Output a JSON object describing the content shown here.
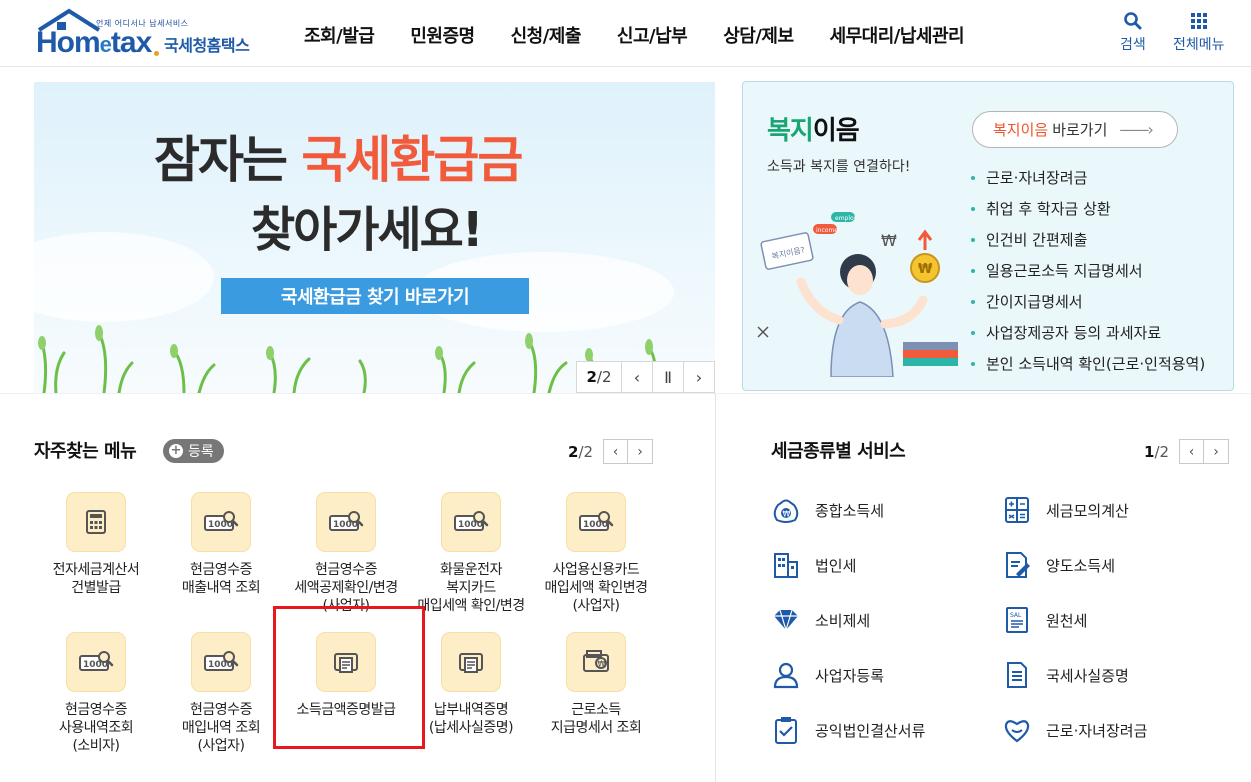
{
  "header": {
    "logo_tagline": "언제 어디서나 납세서비스",
    "logo_word_start": "Hom",
    "logo_word_e": "e",
    "logo_word_end": "tax",
    "logo_kr": "국세청홈택스",
    "nav": [
      "조회/발급",
      "민원증명",
      "신청/제출",
      "신고/납부",
      "상담/제보",
      "세무대리/납세관리"
    ],
    "search_label": "검색",
    "menu_label": "전체메뉴"
  },
  "banner": {
    "line1_prefix": "잠자는 ",
    "line1_highlight": "국세환급금",
    "line2": "찾아가세요!",
    "cta": "국세환급금 찾기 바로가기",
    "page_current": "2",
    "page_sep": "/",
    "page_total": "2",
    "prev_icon": "‹",
    "pause_icon": "Ⅱ",
    "next_icon": "›"
  },
  "welfare": {
    "title_green": "복지",
    "title_rest": "이음",
    "subtitle": "소득과 복지를 연결하다!",
    "button_red": "복지이음",
    "button_rest": "바로가기",
    "items": [
      "근로·자녀장려금",
      "취업 후 학자금 상환",
      "인건비 간편제출",
      "일용근로소득 지급명세서",
      "간이지급명세서",
      "사업장제공자 등의 과세자료",
      "본인 소득내역 확인(근로·인적용역)"
    ],
    "sign_text": "복지이음?",
    "tag1": "employ",
    "tag2": "income"
  },
  "favorites": {
    "title": "자주찾는 메뉴",
    "add_label": "등록",
    "page_current": "2",
    "page_total": "/2",
    "items": [
      {
        "label": "전자세금계산서\n건별발급",
        "icon": "calculator-icon"
      },
      {
        "label": "현금영수증\n매출내역 조회",
        "icon": "receipt-search-icon"
      },
      {
        "label": "현금영수증\n세액공제확인/변경\n(사업자)",
        "icon": "receipt-search-icon"
      },
      {
        "label": "화물운전자\n복지카드\n매입세액 확인/변경",
        "icon": "receipt-search-icon"
      },
      {
        "label": "사업용신용카드\n매입세액 확인변경\n(사업자)",
        "icon": "receipt-search-icon"
      },
      {
        "label": "현금영수증\n사용내역조회\n(소비자)",
        "icon": "receipt-search-icon"
      },
      {
        "label": "현금영수증\n매입내역 조회\n(사업자)",
        "icon": "receipt-search-icon"
      },
      {
        "label": "소득금액증명발급",
        "icon": "printer-icon"
      },
      {
        "label": "납부내역증명\n(납세사실증명)",
        "icon": "printer-icon"
      },
      {
        "label": "근로소득\n지급명세서 조회",
        "icon": "wallet-icon"
      }
    ],
    "money_text": "1000"
  },
  "tax_services": {
    "title": "세금종류별 서비스",
    "page_current": "1",
    "page_total": "/2",
    "items": [
      {
        "label": "종합소득세",
        "icon": "money-bag-icon"
      },
      {
        "label": "세금모의계산",
        "icon": "calculator-icon"
      },
      {
        "label": "법인세",
        "icon": "building-icon"
      },
      {
        "label": "양도소득세",
        "icon": "document-edit-icon"
      },
      {
        "label": "소비제세",
        "icon": "diamond-icon"
      },
      {
        "label": "원천세",
        "icon": "receipt-icon"
      },
      {
        "label": "사업자등록",
        "icon": "person-icon"
      },
      {
        "label": "국세사실증명",
        "icon": "document-icon"
      },
      {
        "label": "공익법인결산서류",
        "icon": "clipboard-icon"
      },
      {
        "label": "근로·자녀장려금",
        "icon": "heart-hands-icon"
      }
    ]
  },
  "colors": {
    "brand_blue": "#1f5aa8",
    "accent_red": "#f15a3a",
    "welfare_green": "#19a672",
    "highlight_red": "#e8161d",
    "tile_bg": "#fdeec8"
  }
}
